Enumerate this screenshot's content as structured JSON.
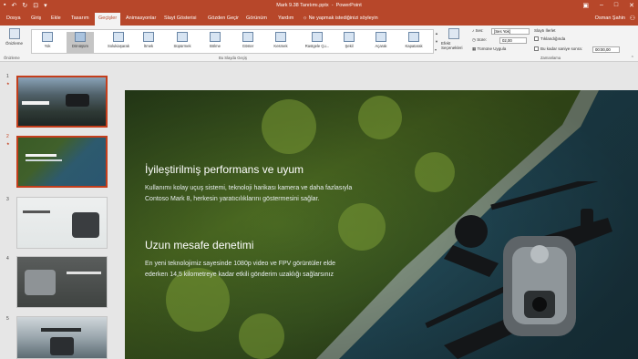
{
  "window": {
    "file": "Mark 9.38 Tanıtımı.pptx",
    "app": "PowerPoint",
    "user": "Osman Şahin"
  },
  "tabs": [
    "Dosya",
    "Giriş",
    "Ekle",
    "Tasarım",
    "Geçişler",
    "Animasyonlar",
    "Slayt Gösterisi",
    "Gözden Geçir",
    "Görünüm",
    "Yardım"
  ],
  "tell_me": "Ne yapmak istediğinizi söyleyin",
  "ribbon": {
    "preview": "Önizleme",
    "preview_group": "Önizleme",
    "transitions": [
      "Yok",
      "Dönüşüm",
      "Solukiaşarak",
      "İtmek",
      "Süpürmek",
      "Bölme",
      "Göster",
      "Kesmek",
      "Rastgele Çu...",
      "Şekil",
      "Açarak",
      "Kapatarak"
    ],
    "selected_index": 1,
    "gallery_group": "Bu Slayda Geçiş",
    "effect_options": "Efekt Seçenekleri",
    "sound_label": "Ses:",
    "sound_value": "[Ses Yok]",
    "duration_label": "Süre:",
    "duration_value": "02,00",
    "apply_all": "Tümüne Uygula",
    "advance_label": "Slaytı İlerlet",
    "on_click": "Tıklandığında",
    "after_label": "Bu kadar saniye sonra:",
    "after_value": "00:00,00",
    "timing_group": "Zamanlama"
  },
  "thumbnails": [
    "1",
    "2",
    "3",
    "4",
    "5"
  ],
  "slide": {
    "title1": "İyileştirilmiş performans ve uyum",
    "body1a": "Kullanımı kolay uçuş sistemi, teknoloji harikası kamera ve daha fazlasıyla",
    "body1b": "Contoso Mark 8, herkesin yaratıcılıklarını göstermesini sağlar.",
    "title2": "Uzun mesafe denetimi",
    "body2a": "En yeni teknolojimiz sayesinde 1080p video ve FPV görüntüler elde",
    "body2b": "ederken 14,5 kilometreye kadar etkili gönderim uzaklığı sağlarsınız"
  }
}
